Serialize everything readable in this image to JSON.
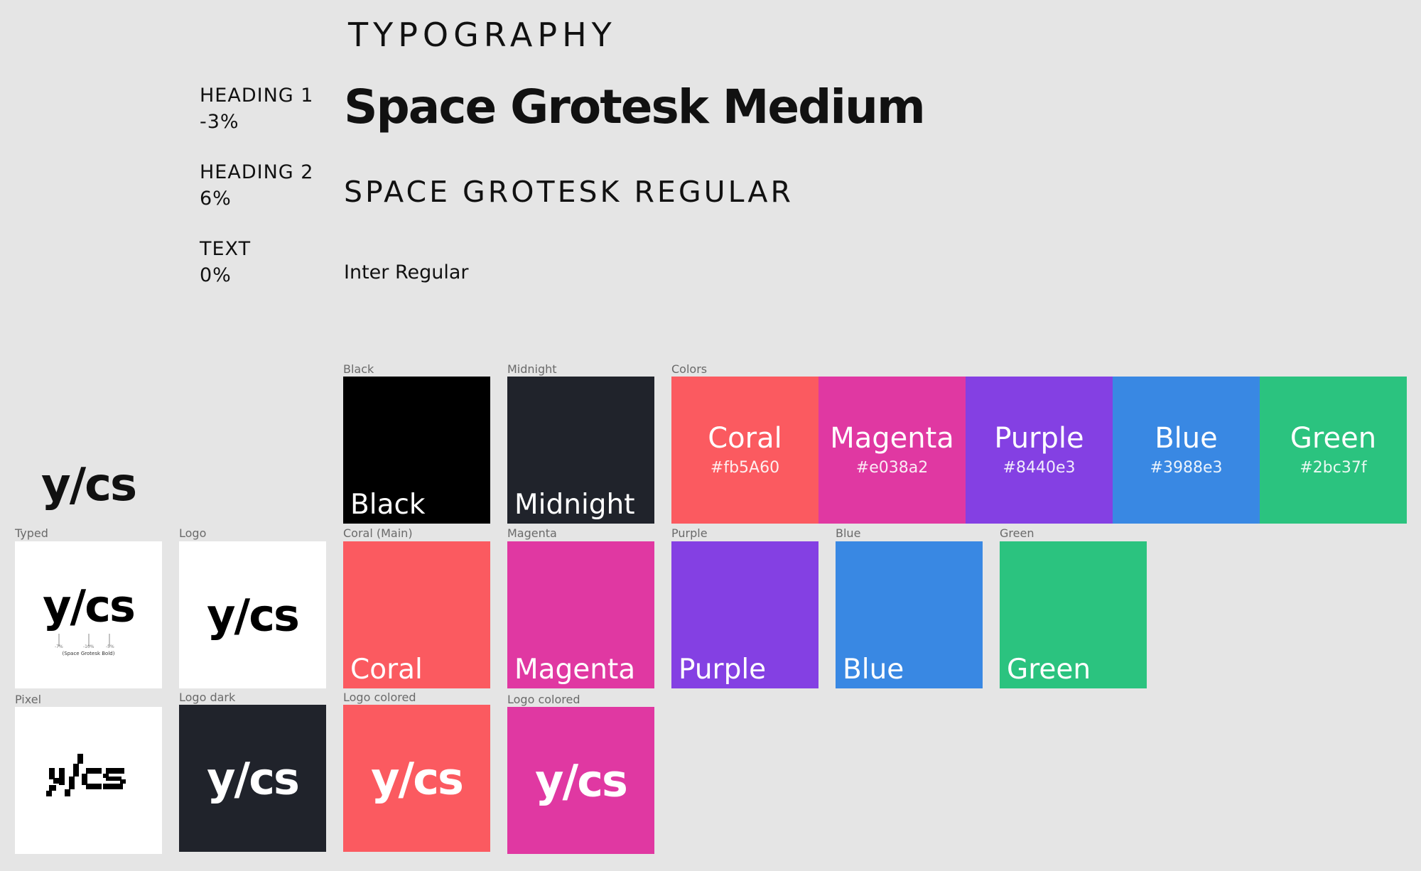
{
  "typography": {
    "title": "TYPOGRAPHY",
    "rows": [
      {
        "label": "HEADING 1\n-3%",
        "sample": "Space Grotesk Medium"
      },
      {
        "label": "HEADING 2\n6%",
        "sample": "SPACE GROTESK REGULAR"
      },
      {
        "label": "TEXT\n0%",
        "sample": "Inter Regular"
      }
    ]
  },
  "brand": {
    "wordmark": "y/cs",
    "typed_caption": "Typed",
    "typed_note": "(Space Grotesk Bold)",
    "typed_tick_labels": [
      "-7%",
      "-10%",
      "-5%"
    ],
    "logo_caption": "Logo",
    "pixel_caption": "Pixel",
    "logo_dark_caption": "Logo dark",
    "logo_colored_caption_1": "Logo colored",
    "logo_colored_caption_2": "Logo colored"
  },
  "palette": {
    "neutrals": [
      {
        "caption": "Black",
        "name": "Black",
        "color": "#000000"
      },
      {
        "caption": "Midnight",
        "name": "Midnight",
        "color": "#20232b"
      }
    ],
    "colors_caption": "Colors",
    "strip": [
      {
        "name": "Coral",
        "hex": "#fb5A60",
        "color": "#fb5a60"
      },
      {
        "name": "Magenta",
        "hex": "#e038a2",
        "color": "#e038a2"
      },
      {
        "name": "Purple",
        "hex": "#8440e3",
        "color": "#8440e3"
      },
      {
        "name": "Blue",
        "hex": "#3988e3",
        "color": "#3988e3"
      },
      {
        "name": "Green",
        "hex": "#2bc37f",
        "color": "#2bc37f"
      }
    ],
    "swatches": [
      {
        "caption": "Coral (Main)",
        "name": "Coral",
        "color": "#fb5a60"
      },
      {
        "caption": "Magenta",
        "name": "Magenta",
        "color": "#e038a2"
      },
      {
        "caption": "Purple",
        "name": "Purple",
        "color": "#8440e3"
      },
      {
        "caption": "Blue",
        "name": "Blue",
        "color": "#3988e3"
      },
      {
        "caption": "Green",
        "name": "Green",
        "color": "#2bc37f"
      }
    ]
  }
}
